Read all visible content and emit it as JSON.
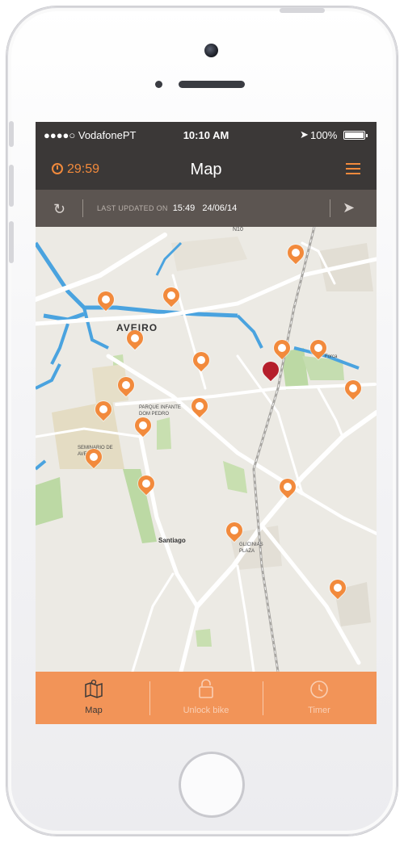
{
  "statusbar": {
    "carrier": "●●●●○ VodafonePT",
    "time": "10:10 AM",
    "location_icon": "location-arrow-icon",
    "battery": "100%"
  },
  "navbar": {
    "timer": "29:59",
    "title": "Map",
    "menu_icon": "hamburger-menu-icon"
  },
  "updatebar": {
    "label": "LAST UPDATED ON",
    "time": "15:49",
    "date": "24/06/14"
  },
  "map": {
    "labels": {
      "city": "AVEIRO",
      "santiago": "Santiago",
      "parque": "PARQUE INFANTE DOM PEDRO",
      "seminario": "SEMINARIO DE AVEIRO",
      "glicinias": "GLICINIAS PLAZA",
      "forca": "Forca",
      "n1": "N10"
    }
  },
  "tabbar": {
    "tabs": [
      {
        "label": "Map",
        "icon": "map-icon"
      },
      {
        "label": "Unlock bike",
        "icon": "lock-icon"
      },
      {
        "label": "Timer",
        "icon": "timer-icon"
      }
    ]
  },
  "colors": {
    "accent": "#f28a3c",
    "tabbar": "#f29458",
    "header": "#3b3837",
    "updatebar": "#5c5551",
    "selected_pin": "#b51f2b"
  }
}
